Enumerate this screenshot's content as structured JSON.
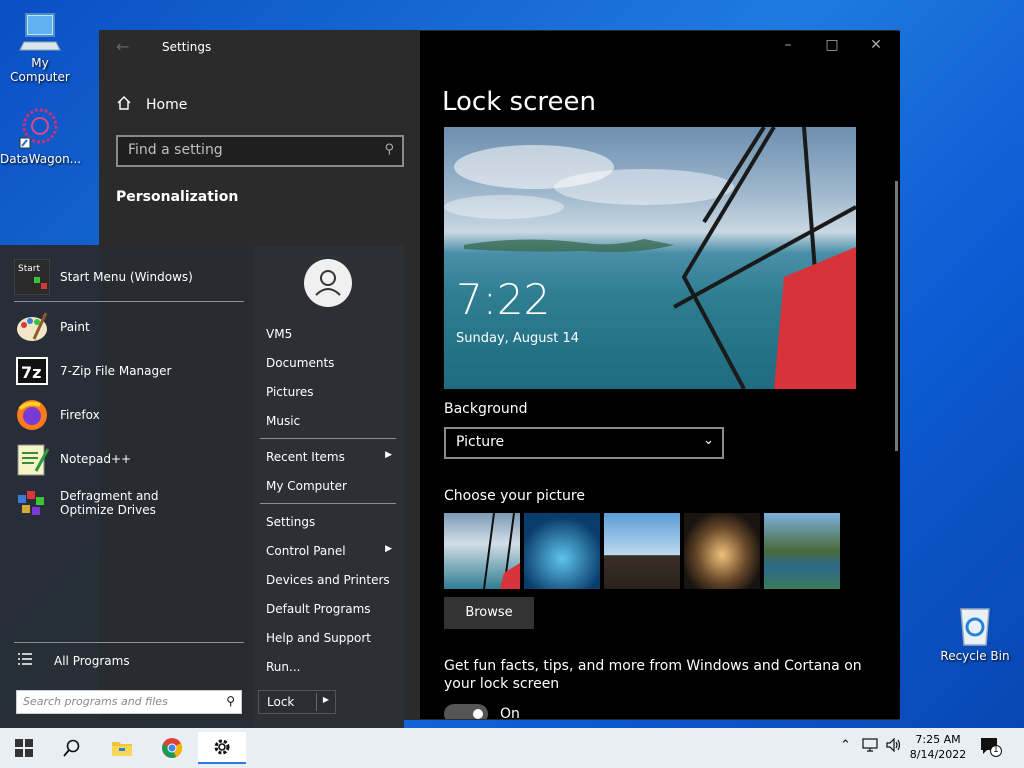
{
  "desktop": {
    "icons": [
      {
        "label": "My Computer"
      },
      {
        "label": "DataWagon..."
      },
      {
        "label": "Recycle Bin"
      }
    ]
  },
  "settings": {
    "title": "Settings",
    "home": "Home",
    "search_placeholder": "Find a setting",
    "section": "Personalization",
    "page_title": "Lock screen",
    "preview_time": "7:22",
    "preview_date": "Sunday, August 14",
    "background_label": "Background",
    "background_value": "Picture",
    "choose_label": "Choose your picture",
    "browse": "Browse",
    "facts": "Get fun facts, tips, and more from Windows and Cortana on your lock screen",
    "toggle_state": "On"
  },
  "start_menu": {
    "programs": [
      {
        "label": "Start Menu (Windows)",
        "icon": "start-menu-icon"
      },
      {
        "label": "Paint",
        "icon": "paint-icon"
      },
      {
        "label": "7-Zip File Manager",
        "icon": "7zip-icon"
      },
      {
        "label": "Firefox",
        "icon": "firefox-icon"
      },
      {
        "label": "Notepad++",
        "icon": "notepadpp-icon"
      },
      {
        "label": "Defragment and Optimize Drives",
        "icon": "defrag-icon"
      }
    ],
    "start_icon_text": "Start",
    "zip_icon_text": "7z",
    "all_programs": "All Programs",
    "search_placeholder": "Search programs and files",
    "right_items": [
      {
        "label": "VM5"
      },
      {
        "label": "Documents"
      },
      {
        "label": "Pictures"
      },
      {
        "label": "Music"
      },
      {
        "label": "Recent Items"
      },
      {
        "label": "My Computer"
      },
      {
        "label": "Settings"
      },
      {
        "label": "Control Panel"
      },
      {
        "label": "Devices and Printers"
      },
      {
        "label": "Default Programs"
      },
      {
        "label": "Help and Support"
      },
      {
        "label": "Run..."
      }
    ],
    "lock": "Lock"
  },
  "taskbar": {
    "time": "7:25 AM",
    "date": "8/14/2022",
    "notification_count": "1"
  },
  "colors": {
    "accent": "#2f7bd8",
    "desktop": "#1f7ae0"
  }
}
